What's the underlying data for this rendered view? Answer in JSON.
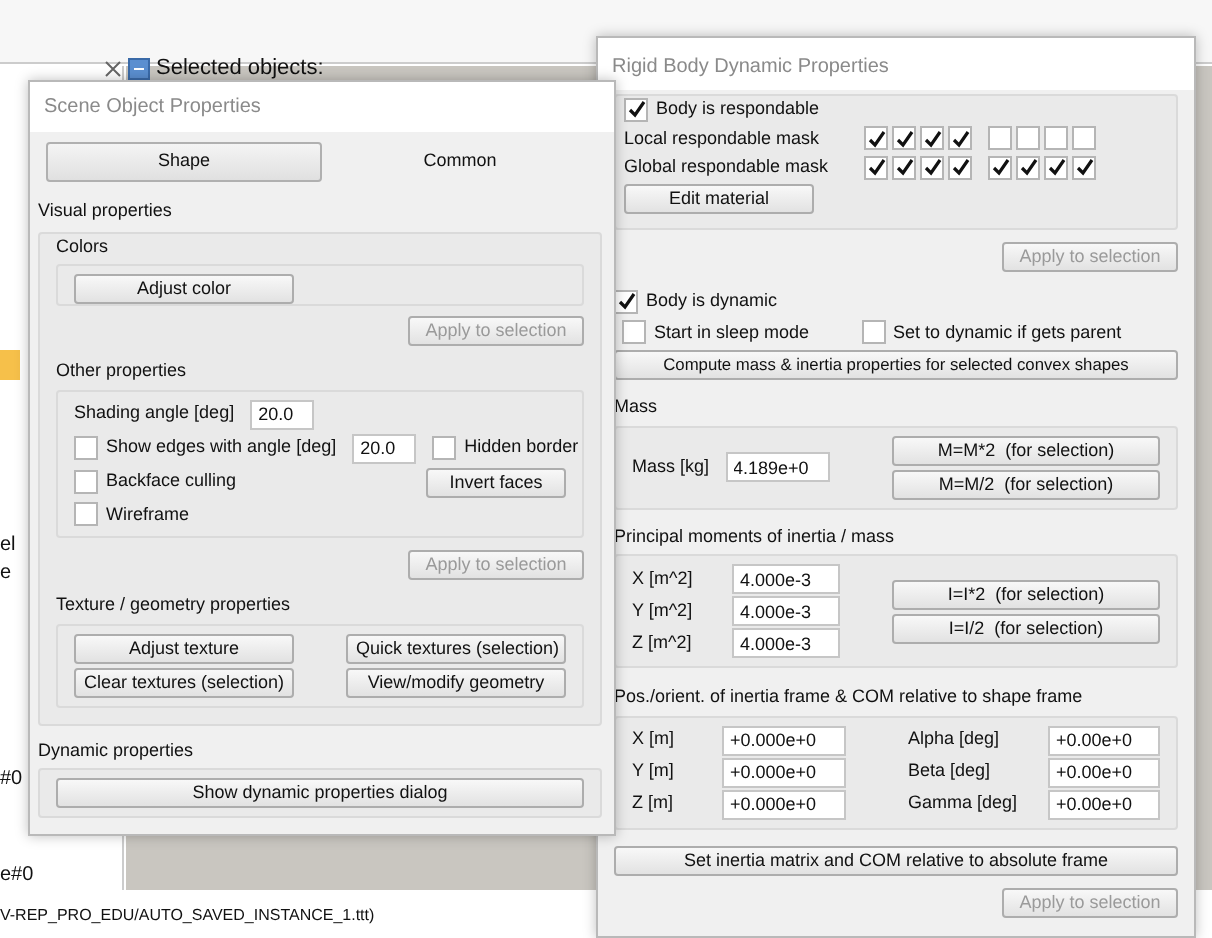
{
  "app": {
    "toolbar_text": "Selected objects:",
    "hierarchy_fragments": [
      "el",
      "e",
      "#0",
      "e#0"
    ],
    "status_line": "V-REP_PRO_EDU/AUTO_SAVED_INSTANCE_1.ttt)"
  },
  "scene_dialog": {
    "title": "Scene Object Properties",
    "tabs": [
      {
        "label": "Shape",
        "selected": true
      },
      {
        "label": "Common",
        "selected": false
      }
    ],
    "visual_label": "Visual properties",
    "colors_label": "Colors",
    "adjust_color": "Adjust color",
    "apply_colors": {
      "label": "Apply to selection",
      "disabled": true
    },
    "other_label": "Other properties",
    "shading_label": "Shading angle [deg]",
    "shading_value": "20.0",
    "show_edges": {
      "label": "Show edges with angle [deg]",
      "checked": false,
      "value": "20.0"
    },
    "hidden_border": {
      "label": "Hidden border",
      "checked": false
    },
    "backface": {
      "label": "Backface culling",
      "checked": false
    },
    "wireframe": {
      "label": "Wireframe",
      "checked": false
    },
    "invert_faces": "Invert faces",
    "apply_other": {
      "label": "Apply to selection",
      "disabled": true
    },
    "texture_label": "Texture / geometry properties",
    "texture_buttons": [
      "Adjust texture",
      "Quick textures (selection)",
      "Clear textures (selection)",
      "View/modify geometry"
    ],
    "dynamic_label": "Dynamic properties",
    "dynamic_button": "Show dynamic properties dialog"
  },
  "rigid_dialog": {
    "title": "Rigid Body Dynamic Properties",
    "respondable": {
      "label": "Body is respondable",
      "checked": true
    },
    "local_mask": {
      "label": "Local respondable mask",
      "bits": [
        true,
        true,
        true,
        true,
        false,
        false,
        false,
        false
      ]
    },
    "global_mask": {
      "label": "Global respondable mask",
      "bits": [
        true,
        true,
        true,
        true,
        true,
        true,
        true,
        true
      ]
    },
    "edit_material": "Edit material",
    "apply_top": {
      "label": "Apply to selection",
      "disabled": true
    },
    "dynamic": {
      "label": "Body is dynamic",
      "checked": true
    },
    "sleep": {
      "label": "Start in sleep mode",
      "checked": false
    },
    "set_dynamic": {
      "label": "Set to dynamic if gets parent",
      "checked": false
    },
    "compute": "Compute mass & inertia properties for selected convex shapes",
    "mass_label": "Mass",
    "mass": {
      "label": "Mass [kg]",
      "value": "4.189e+0"
    },
    "mass_buttons": [
      "M=M*2  (for selection)",
      "M=M/2  (for selection)"
    ],
    "inertia_label": "Principal moments of inertia / mass",
    "inertia": [
      {
        "label": "X [m^2]",
        "value": "4.000e-3"
      },
      {
        "label": "Y [m^2]",
        "value": "4.000e-3"
      },
      {
        "label": "Z [m^2]",
        "value": "4.000e-3"
      }
    ],
    "inertia_buttons": [
      "I=I*2  (for selection)",
      "I=I/2  (for selection)"
    ],
    "frame_label": "Pos./orient. of inertia frame & COM relative to shape frame",
    "frame_rows": [
      {
        "pos_label": "X [m]",
        "pos_value": "+0.000e+0",
        "rot_label": "Alpha [deg]",
        "rot_value": "+0.00e+0"
      },
      {
        "pos_label": "Y [m]",
        "pos_value": "+0.000e+0",
        "rot_label": "Beta [deg]",
        "rot_value": "+0.00e+0"
      },
      {
        "pos_label": "Z [m]",
        "pos_value": "+0.000e+0",
        "rot_label": "Gamma [deg]",
        "rot_value": "+0.00e+0"
      }
    ],
    "set_inertia": "Set inertia matrix and COM relative to absolute frame",
    "apply_bottom": {
      "label": "Apply to selection",
      "disabled": true
    }
  }
}
